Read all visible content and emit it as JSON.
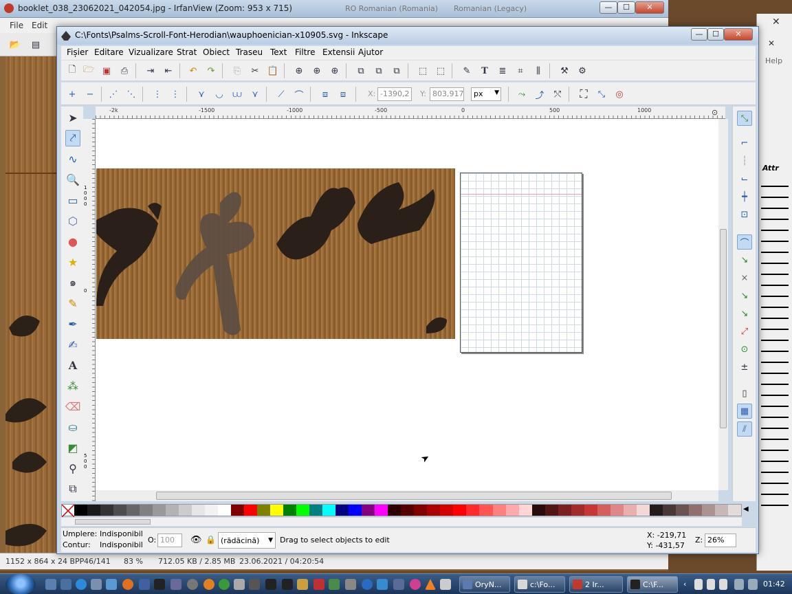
{
  "irfanview": {
    "title": "booklet_038_23062021_042054.jpg - IrfanView (Zoom: 953 x 715)",
    "lang_indicator_1": "RO Romanian (Romania)",
    "lang_indicator_2": "Romanian (Legacy)",
    "menu": [
      "File",
      "Edit"
    ],
    "status": {
      "dims": "1152 x 864 x 24 BPP",
      "index": "46/141",
      "zoom": "83 %",
      "size": "712.05 KB / 2.85 MB",
      "date": "23.06.2021 / 04:20:54"
    }
  },
  "inkscape": {
    "title": "C:\\Fonts\\Psalms-Scroll-Font-Herodian\\wauphoenician-x10905.svg - Inkscape",
    "menu": [
      "Fișier",
      "Editare",
      "Vizualizare",
      "Strat",
      "Obiect",
      "Traseu",
      "Text",
      "Filtre",
      "Extensii",
      "Ajutor"
    ],
    "controls": {
      "x_label": "X:",
      "x_value": "-1390,2",
      "y_label": "Y:",
      "y_value": "803,917",
      "unit": "px"
    },
    "ruler_labels": [
      "-2k",
      "-1500",
      "-1000",
      "-500",
      "0",
      "500",
      "1000"
    ],
    "vertical_ruler_labels": [
      "1000",
      "0",
      "500"
    ],
    "tools": [
      "selector-tool",
      "node-tool",
      "tweak-tool",
      "zoom-tool",
      "rectangle-tool",
      "3d-box-tool",
      "ellipse-tool",
      "star-tool",
      "spiral-tool",
      "pencil-tool",
      "pen-tool",
      "calligraphy-tool",
      "text-tool",
      "spray-tool",
      "eraser-tool",
      "bucket-tool",
      "gradient-tool",
      "dropper-tool",
      "connector-tool"
    ],
    "selected_tool": "node-tool",
    "palette": [
      "#000000",
      "#1a1a1a",
      "#333333",
      "#4d4d4d",
      "#666666",
      "#808080",
      "#999999",
      "#b3b3b3",
      "#cccccc",
      "#e6e6e6",
      "#f2f2f2",
      "#ffffff",
      "#800000",
      "#ff0000",
      "#808000",
      "#ffff00",
      "#008000",
      "#00ff00",
      "#008080",
      "#00ffff",
      "#000080",
      "#0000ff",
      "#800080",
      "#ff00ff",
      "#2b0000",
      "#550000",
      "#800000",
      "#aa0000",
      "#d40000",
      "#ff0000",
      "#ff2a2a",
      "#ff5555",
      "#ff8080",
      "#ffaaaa",
      "#ffd5d5",
      "#280b0b",
      "#501616",
      "#782121",
      "#a02c2c",
      "#c83737",
      "#d35f5f",
      "#de8787",
      "#e9afaf",
      "#f4d7d7",
      "#241c1c",
      "#483737",
      "#6c5353",
      "#916f6f",
      "#ac9393",
      "#c8b7b7",
      "#e3dbdb"
    ],
    "status": {
      "fill_label": "Umplere:",
      "fill_value": "Indisponibil",
      "stroke_label": "Contur:",
      "stroke_value": "Indisponibil",
      "opacity_label": "O:",
      "opacity_value": "100",
      "layer": "(rădăcină)",
      "message": "Drag to select objects to edit",
      "cursor_x": "X: -219,71",
      "cursor_y": "Y: -431,57",
      "zoom_label": "Z:",
      "zoom_value": "26%"
    }
  },
  "right_panel": {
    "help": "Help",
    "attr": "Attr"
  },
  "taskbar": {
    "buttons": [
      {
        "label": "OryN..."
      },
      {
        "label": "c:\\Fo..."
      },
      {
        "label": "2 Ir..."
      },
      {
        "label": "C:\\F..."
      }
    ],
    "clock": "01:42"
  }
}
